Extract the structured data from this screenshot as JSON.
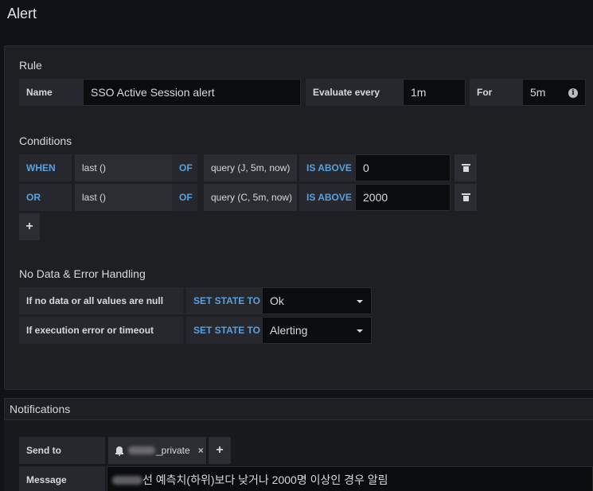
{
  "page": {
    "title": "Alert"
  },
  "rule": {
    "section_title": "Rule",
    "name_label": "Name",
    "name_value": "SSO Active Session alert",
    "evaluate_label": "Evaluate every",
    "evaluate_value": "1m",
    "for_label": "For",
    "for_value": "5m"
  },
  "conditions": {
    "section_title": "Conditions",
    "rows": [
      {
        "operator": "WHEN",
        "reducer": "last ()",
        "of": "OF",
        "query": "query (J, 5m, now)",
        "evaluator": "IS ABOVE",
        "threshold": "0"
      },
      {
        "operator": "OR",
        "reducer": "last ()",
        "of": "OF",
        "query": "query (C, 5m, now)",
        "evaluator": "IS ABOVE",
        "threshold": "2000"
      }
    ],
    "add_label": "+"
  },
  "no_data": {
    "section_title": "No Data & Error Handling",
    "rows": [
      {
        "label": "If no data or all values are null",
        "set_state": "SET STATE TO",
        "value": "Ok"
      },
      {
        "label": "If execution error or timeout",
        "set_state": "SET STATE TO",
        "value": "Alerting"
      }
    ]
  },
  "notifications": {
    "section_title": "Notifications",
    "send_to_label": "Send to",
    "channel_suffix": "_private",
    "remove_label": "×",
    "add_label": "+",
    "message_label": "Message",
    "message_text": "선 예측치(하위)보다 낮거나 2000명 이상인 경우 알림"
  },
  "icons": {
    "info": "info-icon",
    "trash": "trash-icon",
    "bell": "bell-icon",
    "caret": "caret-down-icon"
  },
  "colors": {
    "background": "#111217",
    "panel": "#1e1f23",
    "keyword": "#5aa0e0",
    "input": "#0b0c0e"
  }
}
